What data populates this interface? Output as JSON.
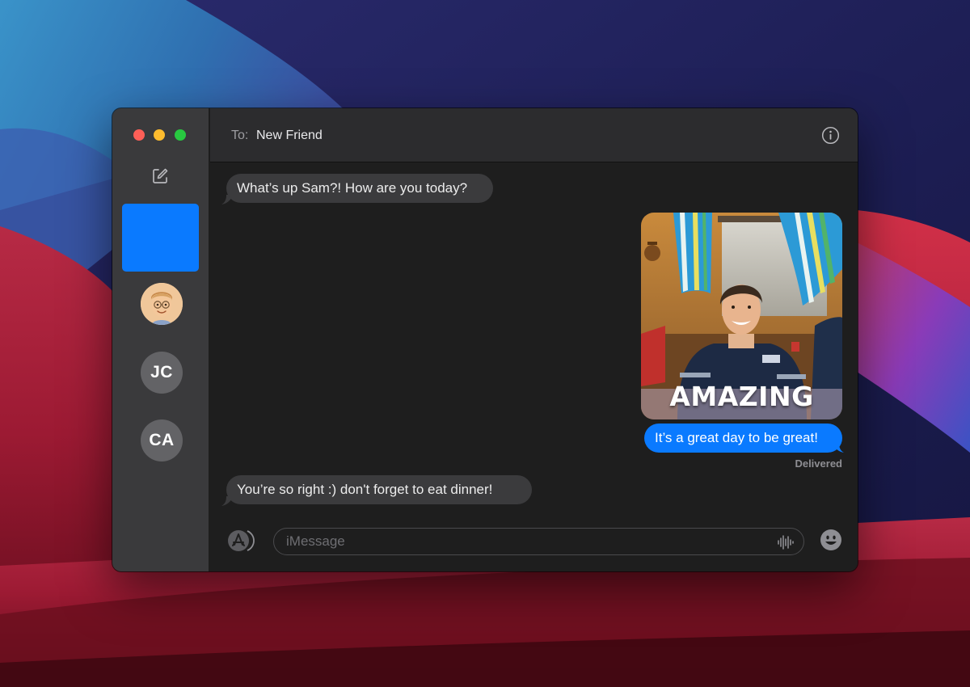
{
  "header": {
    "to_label": "To:",
    "recipient": "New Friend"
  },
  "sidebar": {
    "conversations": [
      {
        "selected": true,
        "initials": "",
        "avatar": "blank"
      },
      {
        "selected": false,
        "initials": "",
        "avatar": "memoji"
      },
      {
        "selected": false,
        "initials": "JC",
        "avatar": "initials"
      },
      {
        "selected": false,
        "initials": "CA",
        "avatar": "initials"
      }
    ]
  },
  "messages": [
    {
      "direction": "incoming",
      "text": "What’s up Sam?! How are you today?"
    },
    {
      "direction": "outgoing",
      "type": "gif",
      "caption": "AMAZING"
    },
    {
      "direction": "outgoing",
      "text": "It’s a great day to be great!",
      "status": "Delivered"
    },
    {
      "direction": "incoming",
      "text": "You’re so right :) don't forget to eat dinner!"
    }
  ],
  "composer": {
    "placeholder": "iMessage",
    "value": ""
  },
  "icons": {
    "compose": "compose-icon",
    "info": "info-icon",
    "apps": "app-store-icon",
    "audio": "waveform-icon",
    "emoji": "emoji-icon"
  },
  "colors": {
    "accent": "#0a7aff",
    "incoming_bubble": "#3b3b3d",
    "close": "#fe5f57",
    "minimize": "#febc2e",
    "maximize": "#28c840"
  }
}
